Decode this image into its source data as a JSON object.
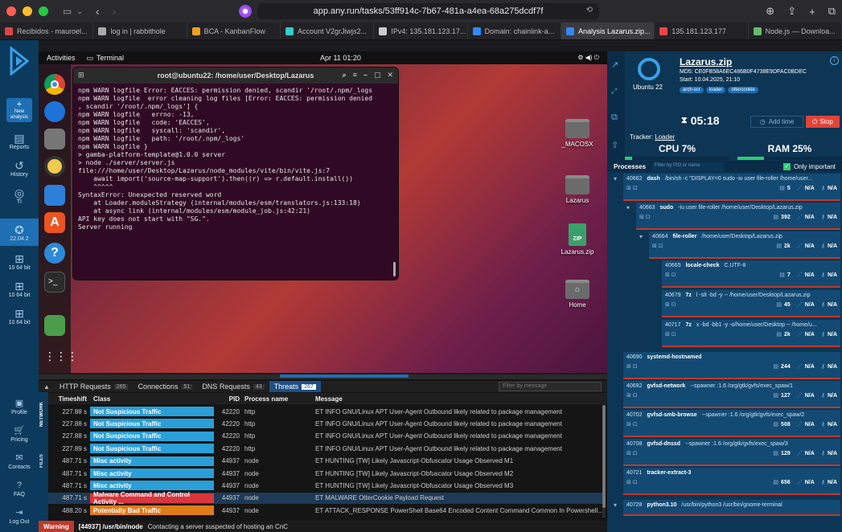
{
  "browser": {
    "url": "app.any.run/tasks/53ff914c-7b67-481a-a4ea-68a275dcdf7f",
    "tabs": [
      {
        "label": "Recibidos - mauroel...",
        "color": "#d44"
      },
      {
        "label": "log in | rabbithole",
        "color": "#aaa"
      },
      {
        "label": "BCA - KanbanFlow",
        "color": "#f0a020"
      },
      {
        "label": "Account V2grJiwjs2...",
        "color": "#3cc"
      },
      {
        "label": "IPv4: 135.181.123.17...",
        "color": "#ccc"
      },
      {
        "label": "Domain: chainlink-a...",
        "color": "#38f"
      },
      {
        "label": "Analysis Lazarus.zip...",
        "color": "#38f",
        "active": true
      },
      {
        "label": "135.181.123.177",
        "color": "#e44"
      },
      {
        "label": "Node.js — Downloa...",
        "color": "#6b6"
      }
    ]
  },
  "sidebar": {
    "new_analysis": "New analysis",
    "items": [
      {
        "label": "Reports",
        "icon": "document-icon"
      },
      {
        "label": "History",
        "icon": "history-icon"
      },
      {
        "label": "TI",
        "icon": "fingerprint-icon"
      },
      {
        "label": "22.04.2",
        "icon": "ubuntu-icon"
      },
      {
        "label": "10 64 bit",
        "icon": "windows-icon"
      },
      {
        "label": "10 64 bit",
        "icon": "windows-icon"
      },
      {
        "label": "10 64 bit",
        "icon": "windows-icon"
      }
    ],
    "bottom": [
      {
        "label": "Profile",
        "icon": "profile-icon"
      },
      {
        "label": "Pricing",
        "icon": "cart-icon"
      },
      {
        "label": "Contacts",
        "icon": "mail-icon"
      },
      {
        "label": "FAQ",
        "icon": "help-icon"
      },
      {
        "label": "Log Out",
        "icon": "logout-icon"
      }
    ]
  },
  "vm": {
    "activities": "Activities",
    "app_name": "Terminal",
    "clock": "Apr 11  01:20",
    "terminal_title": "root@ubuntu22: /home/user/Desktop/Lazarus",
    "terminal_lines": [
      "npm WARN logfile Error: EACCES: permission denied, scandir '/root/.npm/_logs",
      "",
      "npm WARN logfile  error cleaning log files [Error: EACCES: permission denied",
      ", scandir '/root/.npm/_logs'] {",
      "npm WARN logfile   errno: -13,",
      "npm WARN logfile   code: 'EACCES',",
      "npm WARN logfile   syscall: 'scandir',",
      "npm WARN logfile   path: '/root/.npm/_logs'",
      "npm WARN logfile }",
      "",
      "> gamba-platform-template@1.0.0 server",
      "> node ./server/server.js",
      "",
      "file:///home/user/Desktop/Lazarus/node_modules/vite/bin/vite.js:7",
      "    await import('source-map-support').then((r) => r.default.install())",
      "    ^^^^^",
      "",
      "SyntaxError: Unexpected reserved word",
      "    at Loader.moduleStrategy (internal/modules/esm/translators.js:133:18)",
      "    at async link (internal/modules/esm/module_job.js:42:21)",
      "",
      "API key does not start with \"SG.\".",
      "Server running"
    ],
    "desktop_icons": [
      {
        "label": "_MACOSX",
        "type": "folder"
      },
      {
        "label": "Lazarus",
        "type": "folder"
      },
      {
        "label": "Lazarus.zip",
        "type": "zip"
      },
      {
        "label": "Home",
        "type": "home"
      }
    ]
  },
  "network": {
    "side_labels": [
      "NETWORK",
      "FILES"
    ],
    "tabs": [
      {
        "label": "HTTP Requests",
        "count": "265"
      },
      {
        "label": "Connections",
        "count": "51"
      },
      {
        "label": "DNS Requests",
        "count": "43"
      },
      {
        "label": "Threats",
        "count": "267",
        "active": true
      }
    ],
    "filter_placeholder": "Filter by message",
    "columns": [
      "Timeshift",
      "Class",
      "PID",
      "Process name",
      "Message"
    ],
    "rows": [
      {
        "time": "227.88 s",
        "class": "Not Suspicious Traffic",
        "color": "#2a9fd8",
        "pid": "42220",
        "proc": "http",
        "msg": "ET INFO GNU/Linux APT User-Agent Outbound likely related to package management"
      },
      {
        "time": "227.88 s",
        "class": "Not Suspicious Traffic",
        "color": "#2a9fd8",
        "pid": "42220",
        "proc": "http",
        "msg": "ET INFO GNU/Linux APT User-Agent Outbound likely related to package management"
      },
      {
        "time": "227.88 s",
        "class": "Not Suspicious Traffic",
        "color": "#2a9fd8",
        "pid": "42220",
        "proc": "http",
        "msg": "ET INFO GNU/Linux APT User-Agent Outbound likely related to package management"
      },
      {
        "time": "227.89 s",
        "class": "Not Suspicious Traffic",
        "color": "#2a9fd8",
        "pid": "42220",
        "proc": "http",
        "msg": "ET INFO GNU/Linux APT User-Agent Outbound likely related to package management"
      },
      {
        "time": "487.71 s",
        "class": "Misc activity",
        "color": "#2a9fd8",
        "pid": "44937",
        "proc": "node",
        "msg": "ET HUNTING [TW] Likely Javascript-Obfuscator Usage Observed M1"
      },
      {
        "time": "487.71 s",
        "class": "Misc activity",
        "color": "#2a9fd8",
        "pid": "44937",
        "proc": "node",
        "msg": "ET HUNTING [TW] Likely Javascript-Obfuscator Usage Observed M2"
      },
      {
        "time": "487.71 s",
        "class": "Misc activity",
        "color": "#2a9fd8",
        "pid": "44937",
        "proc": "node",
        "msg": "ET HUNTING [TW] Likely Javascript-Obfuscator Usage Observed M3"
      },
      {
        "time": "487.71 s",
        "class": "Malware Command and Control Activity ...",
        "color": "#d9363e",
        "pid": "44937",
        "proc": "node",
        "msg": "ET MALWARE OtterCookie Payload Request",
        "highlight": true
      },
      {
        "time": "488.20 s",
        "class": "Potentially Bad Traffic",
        "color": "#e07b1a",
        "pid": "44937",
        "proc": "node",
        "msg": "ET ATTACK_RESPONSE PowerShell Base64 Encoded Content Command Common In Powershell..."
      }
    ]
  },
  "status_bar": {
    "level": "Warning",
    "process": "[44937] /usr/bin/node",
    "message": "Contacting a server suspected of hosting an CnC"
  },
  "task": {
    "os": "Ubuntu 22",
    "file": "Lazarus.zip",
    "md5": "MD5: CE0FB58A6EC486B0F4738E9DFAC0BDEC",
    "start": "Start: 10.04.2025, 21:10",
    "tags": [
      "arch-scr",
      "loader",
      "ottercookie"
    ],
    "timer": "05:18",
    "add_time": "Add time",
    "stop": "Stop",
    "tracker_label": "Tracker:",
    "tracker_value": "Loader",
    "cpu": "CPU 7%",
    "cpu_value": 7,
    "ram": "RAM 25%",
    "ram_value": 25,
    "processes_label": "Processes",
    "pid_filter_placeholder": "Filter by PID or name",
    "only_important": "Only important",
    "na": "N/A"
  },
  "processes": [
    {
      "pid": "40662",
      "name": "dash",
      "cmd": "/bin/sh -c \"DISPLAY=0 sudo -iu user file-roller /home/user...",
      "files": "5",
      "level": 0,
      "toggle": "▾"
    },
    {
      "pid": "40663",
      "name": "sudo",
      "cmd": "-iu user file-roller /home/user/Desktop/Lazarus.zip",
      "files": "392",
      "level": 1,
      "toggle": "▾"
    },
    {
      "pid": "40664",
      "name": "file-roller",
      "cmd": "/home/user/Desktop/Lazarus.zip",
      "files": "2k",
      "level": 2,
      "toggle": "▾"
    },
    {
      "pid": "40665",
      "name": "locale-check",
      "cmd": "C.UTF-8",
      "files": "7",
      "level": 3,
      "toggle": ""
    },
    {
      "pid": "40679",
      "name": "7z",
      "cmd": "l -slt -bd -y -- /home/user/Desktop/Lazarus.zip",
      "files": "45",
      "level": 3,
      "toggle": ""
    },
    {
      "pid": "40717",
      "name": "7z",
      "cmd": "x -bd -bb1 -y -o/home/user/Desktop -- /home/u...",
      "files": "2k",
      "level": 3,
      "toggle": ""
    },
    {
      "pid": "40690",
      "name": "systemd-hostnamed",
      "cmd": "",
      "files": "244",
      "level": 0,
      "toggle": ""
    },
    {
      "pid": "40692",
      "name": "gvfsd-network",
      "cmd": "--spawner :1.6 /org/gtk/gvfs/exec_spaw/1",
      "files": "127",
      "level": 0,
      "toggle": ""
    },
    {
      "pid": "40702",
      "name": "gvfsd-smb-browse",
      "cmd": "--spawner :1.6 /org/gtk/gvfs/exec_spaw/2",
      "files": "508",
      "level": 0,
      "toggle": ""
    },
    {
      "pid": "40708",
      "name": "gvfsd-dnssd",
      "cmd": "--spawner :1.6 /org/gtk/gvfs/exec_spaw/3",
      "files": "129",
      "level": 0,
      "toggle": ""
    },
    {
      "pid": "40721",
      "name": "tracker-extract-3",
      "cmd": "",
      "files": "656",
      "level": 0,
      "toggle": ""
    },
    {
      "pid": "40728",
      "name": "python3.10",
      "cmd": "/usr/bin/python3 /usr/bin/gnome-terminal",
      "files": "",
      "level": 0,
      "toggle": "▾"
    }
  ]
}
